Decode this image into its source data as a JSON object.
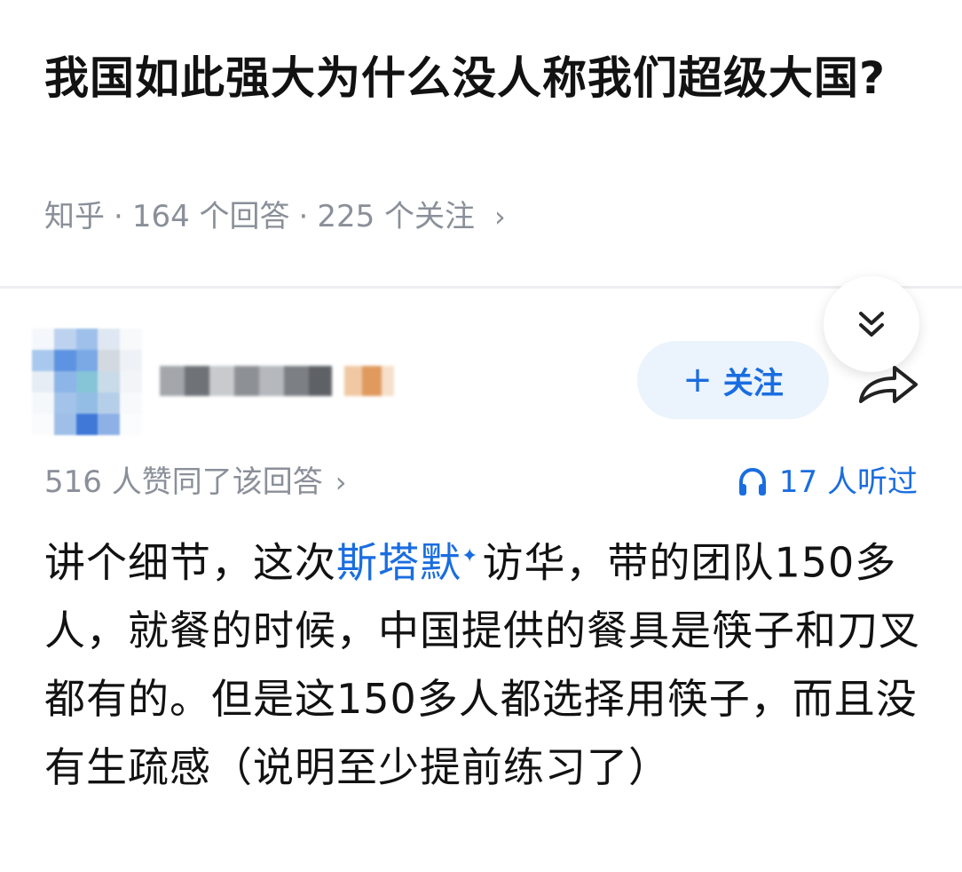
{
  "question": {
    "title": "我国如此强大为什么没人称我们超级大国?"
  },
  "meta": {
    "source": "知乎",
    "answers": "164 个回答",
    "followers": "225 个关注",
    "separator": "·",
    "chevron": "›"
  },
  "answer": {
    "follow_button": {
      "plus": "+",
      "label": "关注"
    },
    "likes": "516 人赞同了该回答",
    "likes_chevron": "›",
    "listened": "17 人听过",
    "content": {
      "part1": "讲个细节，这次",
      "keyword": "斯塔默",
      "keyword_mark": "✦",
      "part2": "访华，带的团队150多人，就餐的时候，中国提供的餐具是筷子和刀叉都有的。但是这150多人都选择用筷子，而且没有生疏感（说明至少提前练习了）"
    }
  },
  "icons": {
    "collapse": "double-chevron-down-icon",
    "share": "share-arrow-icon",
    "headphone": "headphone-icon"
  },
  "colors": {
    "accent": "#1a6de0",
    "follow_bg": "#ebf3fd",
    "meta_gray": "#8a8f99",
    "text": "#121212"
  }
}
